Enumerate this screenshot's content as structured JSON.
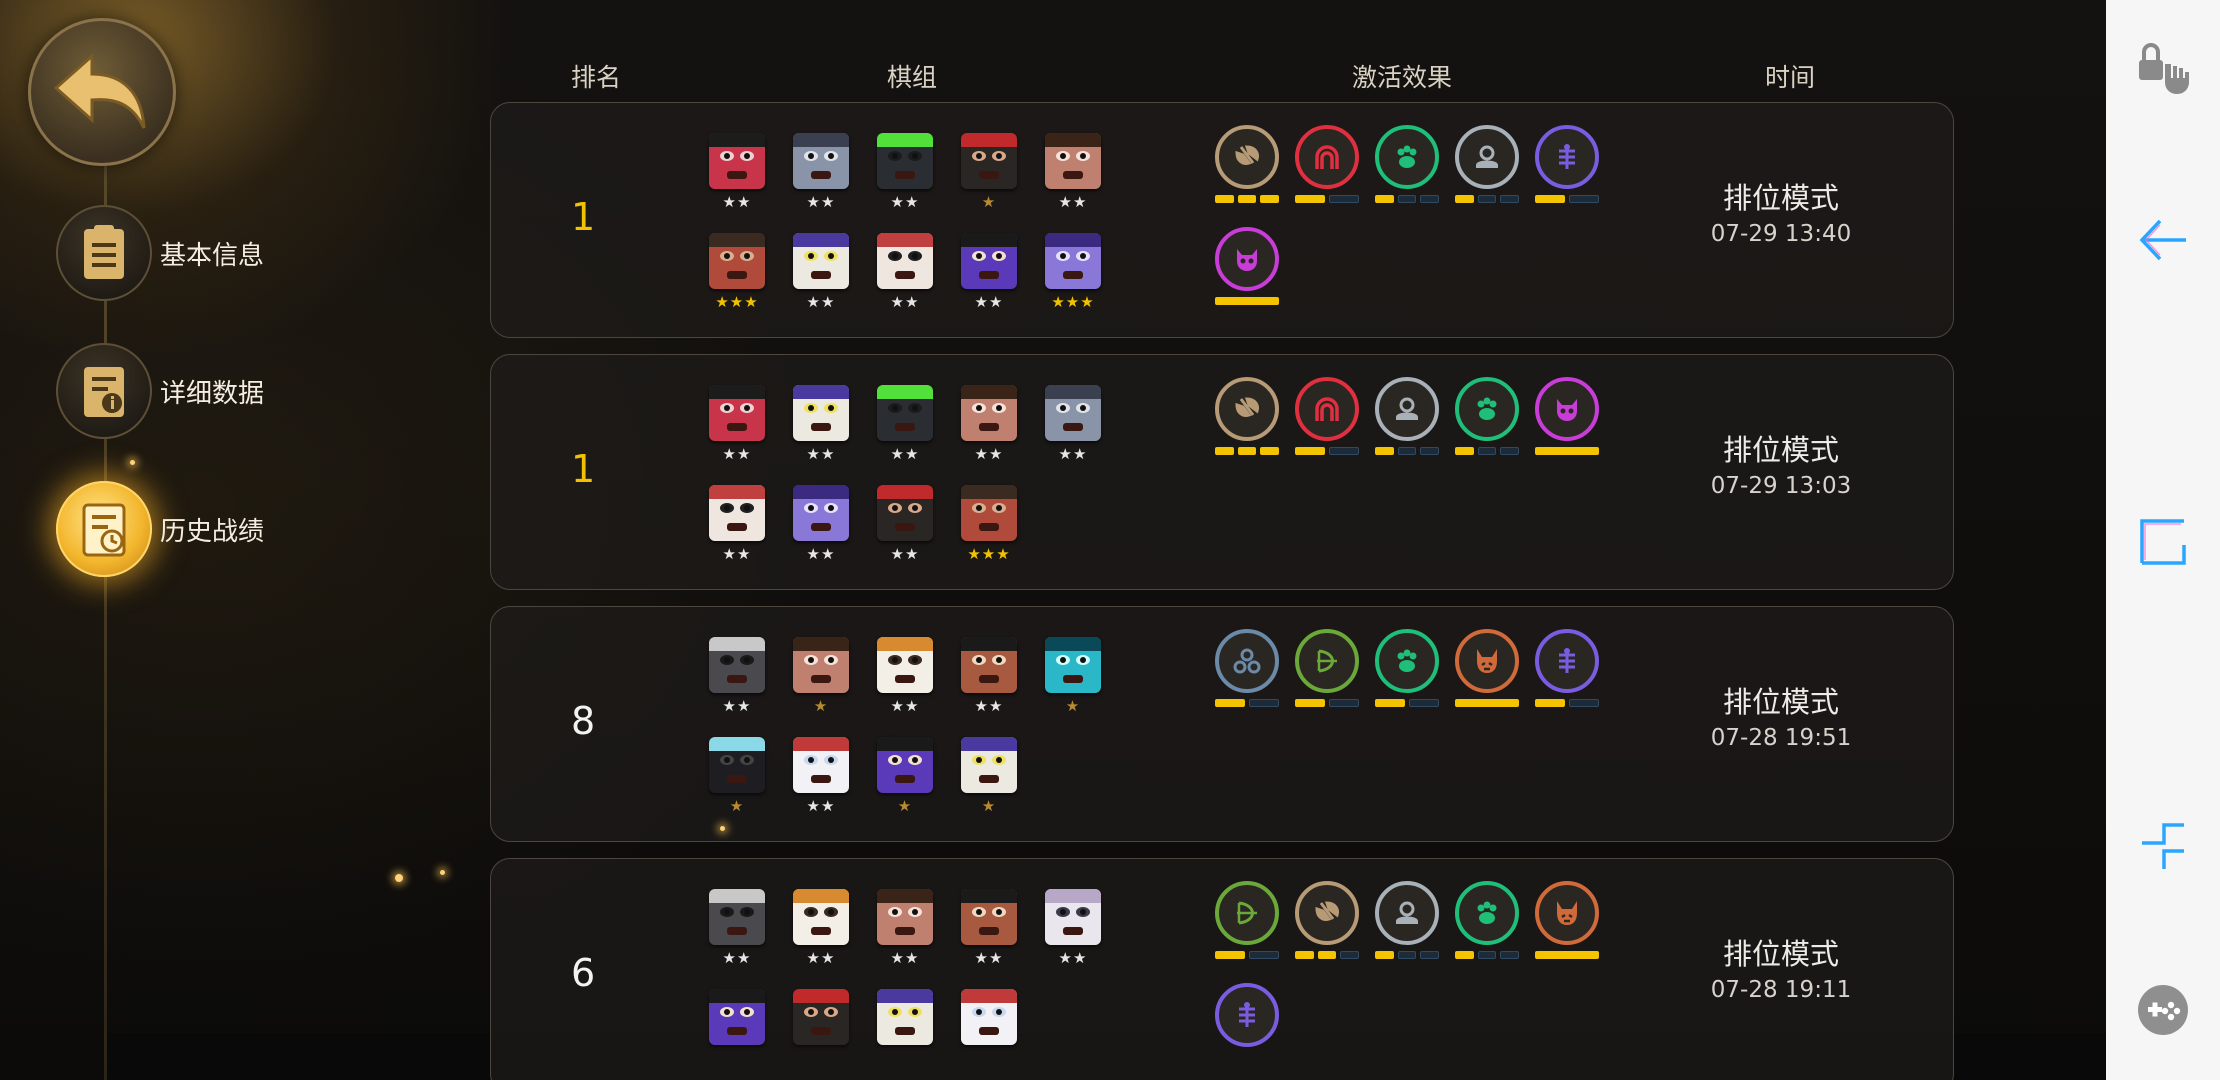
{
  "nav": {
    "items": [
      {
        "label": "基本信息"
      },
      {
        "label": "详细数据"
      },
      {
        "label": "历史战绩"
      }
    ]
  },
  "table": {
    "headers": {
      "rank": "排名",
      "lineup": "棋组",
      "traits": "激活效果",
      "time": "时间"
    }
  },
  "matches": [
    {
      "rank": "1",
      "rank_color": "#f2c200",
      "mode": "排位模式",
      "time": "07-29 13:40",
      "pieces": [
        {
          "icon": "red-masked-warrior",
          "stars": "★★",
          "star_color": "white"
        },
        {
          "icon": "armored-knight",
          "stars": "★★",
          "star_color": "white"
        },
        {
          "icon": "green-orb-robot",
          "stars": "★★",
          "star_color": "white"
        },
        {
          "icon": "long-hair-pirate",
          "stars": "★",
          "star_color": "bronze"
        },
        {
          "icon": "goofy-brute",
          "stars": "★★",
          "star_color": "white"
        },
        {
          "icon": "bearded-bandit",
          "stars": "★★★",
          "star_color": "gold"
        },
        {
          "icon": "purple-hat-wizard",
          "stars": "★★",
          "star_color": "white"
        },
        {
          "icon": "skull-ghost",
          "stars": "★★",
          "star_color": "white"
        },
        {
          "icon": "purple-hair-sunglasses",
          "stars": "★★",
          "star_color": "white"
        },
        {
          "icon": "purple-beast",
          "stars": "★★★",
          "star_color": "gold"
        }
      ],
      "traits": [
        {
          "icon": "axe-icon",
          "color": "#b79a76",
          "bars": [
            1,
            1,
            1
          ]
        },
        {
          "icon": "demon-gate-icon",
          "color": "#e03040",
          "bars": [
            1,
            0
          ]
        },
        {
          "icon": "paw-icon",
          "color": "#1fbf7a",
          "bars": [
            1,
            0,
            0
          ]
        },
        {
          "icon": "crown-icon",
          "color": "#a8b0b8",
          "bars": [
            1,
            0,
            0
          ]
        },
        {
          "icon": "fishbone-icon",
          "color": "#7a5ce0",
          "bars": [
            1,
            0
          ]
        },
        {
          "icon": "demon-skull-icon",
          "color": "#c83cd8",
          "bars": [
            1
          ]
        }
      ]
    },
    {
      "rank": "1",
      "rank_color": "#f2c200",
      "mode": "排位模式",
      "time": "07-29 13:03",
      "pieces": [
        {
          "icon": "red-masked-warrior",
          "stars": "★★",
          "star_color": "white"
        },
        {
          "icon": "purple-hat-wizard",
          "stars": "★★",
          "star_color": "white"
        },
        {
          "icon": "green-orb-robot",
          "stars": "★★",
          "star_color": "white"
        },
        {
          "icon": "goofy-brute",
          "stars": "★★",
          "star_color": "white"
        },
        {
          "icon": "armored-knight",
          "stars": "★★",
          "star_color": "white"
        },
        {
          "icon": "skull-ghost",
          "stars": "★★",
          "star_color": "white"
        },
        {
          "icon": "purple-beast",
          "stars": "★★",
          "star_color": "white"
        },
        {
          "icon": "long-hair-pirate",
          "stars": "★★",
          "star_color": "white"
        },
        {
          "icon": "bearded-bandit",
          "stars": "★★★",
          "star_color": "gold"
        }
      ],
      "traits": [
        {
          "icon": "axe-icon",
          "color": "#b79a76",
          "bars": [
            1,
            1,
            1
          ]
        },
        {
          "icon": "demon-gate-icon",
          "color": "#e03040",
          "bars": [
            1,
            0
          ]
        },
        {
          "icon": "crown-icon",
          "color": "#a8b0b8",
          "bars": [
            1,
            0,
            0
          ]
        },
        {
          "icon": "paw-icon",
          "color": "#1fbf7a",
          "bars": [
            1,
            0,
            0
          ]
        },
        {
          "icon": "demon-skull-icon",
          "color": "#c83cd8",
          "bars": [
            1
          ]
        }
      ]
    },
    {
      "rank": "8",
      "rank_color": "#f2f2f2",
      "mode": "排位模式",
      "time": "07-28 19:51",
      "pieces": [
        {
          "icon": "hooded-assassin",
          "stars": "★★",
          "star_color": "white"
        },
        {
          "icon": "goofy-brute",
          "stars": "★",
          "star_color": "bronze"
        },
        {
          "icon": "white-beard-monk",
          "stars": "★★",
          "star_color": "white"
        },
        {
          "icon": "sunglasses-gunner",
          "stars": "★★",
          "star_color": "white"
        },
        {
          "icon": "cyan-golem",
          "stars": "★",
          "star_color": "bronze"
        },
        {
          "icon": "shadow-ninja",
          "stars": "★",
          "star_color": "bronze"
        },
        {
          "icon": "white-yeti",
          "stars": "★★",
          "star_color": "white"
        },
        {
          "icon": "purple-hair-sunglasses",
          "stars": "★",
          "star_color": "bronze"
        },
        {
          "icon": "purple-hat-wizard",
          "stars": "★",
          "star_color": "bronze"
        }
      ],
      "traits": [
        {
          "icon": "triple-circle-icon",
          "color": "#6a8aa8",
          "bars": [
            1,
            0
          ]
        },
        {
          "icon": "bow-icon",
          "color": "#6aa83a",
          "bars": [
            1,
            0
          ]
        },
        {
          "icon": "paw-icon",
          "color": "#1fbf7a",
          "bars": [
            1,
            0
          ]
        },
        {
          "icon": "horned-beast-icon",
          "color": "#d06a3a",
          "bars": [
            1
          ]
        },
        {
          "icon": "fishbone-icon",
          "color": "#7a5ce0",
          "bars": [
            1,
            0
          ]
        }
      ]
    },
    {
      "rank": "6",
      "rank_color": "#f2f2f2",
      "mode": "排位模式",
      "time": "07-28 19:11",
      "pieces": [
        {
          "icon": "hooded-assassin",
          "stars": "★★",
          "star_color": "white"
        },
        {
          "icon": "white-beard-monk",
          "stars": "★★",
          "star_color": "white"
        },
        {
          "icon": "goofy-brute",
          "stars": "★★",
          "star_color": "white"
        },
        {
          "icon": "sunglasses-gunner",
          "stars": "★★",
          "star_color": "white"
        },
        {
          "icon": "horned-helmet-viking",
          "stars": "★★",
          "star_color": "white"
        },
        {
          "icon": "purple-hair-sunglasses",
          "stars": "",
          "star_color": "white"
        },
        {
          "icon": "long-hair-pirate",
          "stars": "",
          "star_color": "white"
        },
        {
          "icon": "purple-hat-wizard",
          "stars": "",
          "star_color": "white"
        },
        {
          "icon": "white-yeti",
          "stars": "",
          "star_color": "white"
        }
      ],
      "traits": [
        {
          "icon": "bow-icon",
          "color": "#6aa83a",
          "bars": [
            1,
            0
          ]
        },
        {
          "icon": "axe-icon",
          "color": "#b79a76",
          "bars": [
            1,
            1,
            0
          ]
        },
        {
          "icon": "crown-icon",
          "color": "#a8b0b8",
          "bars": [
            1,
            0,
            0
          ]
        },
        {
          "icon": "paw-icon",
          "color": "#1fbf7a",
          "bars": [
            1,
            0,
            0
          ]
        },
        {
          "icon": "horned-beast-icon",
          "color": "#d06a3a",
          "bars": [
            1
          ]
        },
        {
          "icon": "fishbone-icon",
          "color": "#7a5ce0",
          "bars": []
        }
      ]
    }
  ],
  "system_sidebar": {
    "buttons": [
      {
        "icon": "lock-touch-icon"
      },
      {
        "icon": "back-arrow-icon"
      },
      {
        "icon": "recent-apps-icon"
      },
      {
        "icon": "collapse-icon"
      },
      {
        "icon": "gamepad-icon"
      }
    ]
  }
}
